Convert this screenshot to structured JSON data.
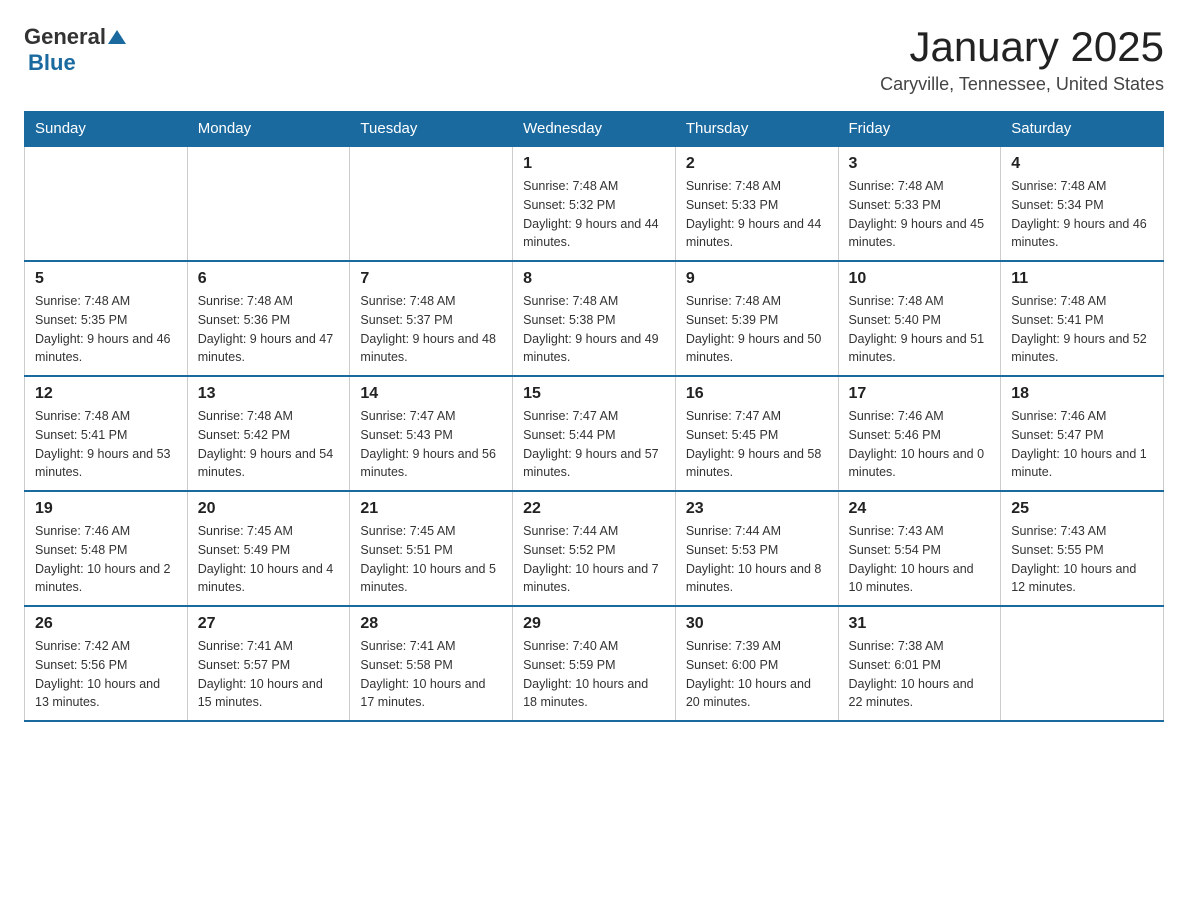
{
  "header": {
    "logo": {
      "general": "General",
      "triangle": "▶",
      "blue": "Blue"
    },
    "title": "January 2025",
    "location": "Caryville, Tennessee, United States"
  },
  "weekdays": [
    "Sunday",
    "Monday",
    "Tuesday",
    "Wednesday",
    "Thursday",
    "Friday",
    "Saturday"
  ],
  "weeks": [
    [
      {
        "day": "",
        "info": ""
      },
      {
        "day": "",
        "info": ""
      },
      {
        "day": "",
        "info": ""
      },
      {
        "day": "1",
        "info": "Sunrise: 7:48 AM\nSunset: 5:32 PM\nDaylight: 9 hours and 44 minutes."
      },
      {
        "day": "2",
        "info": "Sunrise: 7:48 AM\nSunset: 5:33 PM\nDaylight: 9 hours and 44 minutes."
      },
      {
        "day": "3",
        "info": "Sunrise: 7:48 AM\nSunset: 5:33 PM\nDaylight: 9 hours and 45 minutes."
      },
      {
        "day": "4",
        "info": "Sunrise: 7:48 AM\nSunset: 5:34 PM\nDaylight: 9 hours and 46 minutes."
      }
    ],
    [
      {
        "day": "5",
        "info": "Sunrise: 7:48 AM\nSunset: 5:35 PM\nDaylight: 9 hours and 46 minutes."
      },
      {
        "day": "6",
        "info": "Sunrise: 7:48 AM\nSunset: 5:36 PM\nDaylight: 9 hours and 47 minutes."
      },
      {
        "day": "7",
        "info": "Sunrise: 7:48 AM\nSunset: 5:37 PM\nDaylight: 9 hours and 48 minutes."
      },
      {
        "day": "8",
        "info": "Sunrise: 7:48 AM\nSunset: 5:38 PM\nDaylight: 9 hours and 49 minutes."
      },
      {
        "day": "9",
        "info": "Sunrise: 7:48 AM\nSunset: 5:39 PM\nDaylight: 9 hours and 50 minutes."
      },
      {
        "day": "10",
        "info": "Sunrise: 7:48 AM\nSunset: 5:40 PM\nDaylight: 9 hours and 51 minutes."
      },
      {
        "day": "11",
        "info": "Sunrise: 7:48 AM\nSunset: 5:41 PM\nDaylight: 9 hours and 52 minutes."
      }
    ],
    [
      {
        "day": "12",
        "info": "Sunrise: 7:48 AM\nSunset: 5:41 PM\nDaylight: 9 hours and 53 minutes."
      },
      {
        "day": "13",
        "info": "Sunrise: 7:48 AM\nSunset: 5:42 PM\nDaylight: 9 hours and 54 minutes."
      },
      {
        "day": "14",
        "info": "Sunrise: 7:47 AM\nSunset: 5:43 PM\nDaylight: 9 hours and 56 minutes."
      },
      {
        "day": "15",
        "info": "Sunrise: 7:47 AM\nSunset: 5:44 PM\nDaylight: 9 hours and 57 minutes."
      },
      {
        "day": "16",
        "info": "Sunrise: 7:47 AM\nSunset: 5:45 PM\nDaylight: 9 hours and 58 minutes."
      },
      {
        "day": "17",
        "info": "Sunrise: 7:46 AM\nSunset: 5:46 PM\nDaylight: 10 hours and 0 minutes."
      },
      {
        "day": "18",
        "info": "Sunrise: 7:46 AM\nSunset: 5:47 PM\nDaylight: 10 hours and 1 minute."
      }
    ],
    [
      {
        "day": "19",
        "info": "Sunrise: 7:46 AM\nSunset: 5:48 PM\nDaylight: 10 hours and 2 minutes."
      },
      {
        "day": "20",
        "info": "Sunrise: 7:45 AM\nSunset: 5:49 PM\nDaylight: 10 hours and 4 minutes."
      },
      {
        "day": "21",
        "info": "Sunrise: 7:45 AM\nSunset: 5:51 PM\nDaylight: 10 hours and 5 minutes."
      },
      {
        "day": "22",
        "info": "Sunrise: 7:44 AM\nSunset: 5:52 PM\nDaylight: 10 hours and 7 minutes."
      },
      {
        "day": "23",
        "info": "Sunrise: 7:44 AM\nSunset: 5:53 PM\nDaylight: 10 hours and 8 minutes."
      },
      {
        "day": "24",
        "info": "Sunrise: 7:43 AM\nSunset: 5:54 PM\nDaylight: 10 hours and 10 minutes."
      },
      {
        "day": "25",
        "info": "Sunrise: 7:43 AM\nSunset: 5:55 PM\nDaylight: 10 hours and 12 minutes."
      }
    ],
    [
      {
        "day": "26",
        "info": "Sunrise: 7:42 AM\nSunset: 5:56 PM\nDaylight: 10 hours and 13 minutes."
      },
      {
        "day": "27",
        "info": "Sunrise: 7:41 AM\nSunset: 5:57 PM\nDaylight: 10 hours and 15 minutes."
      },
      {
        "day": "28",
        "info": "Sunrise: 7:41 AM\nSunset: 5:58 PM\nDaylight: 10 hours and 17 minutes."
      },
      {
        "day": "29",
        "info": "Sunrise: 7:40 AM\nSunset: 5:59 PM\nDaylight: 10 hours and 18 minutes."
      },
      {
        "day": "30",
        "info": "Sunrise: 7:39 AM\nSunset: 6:00 PM\nDaylight: 10 hours and 20 minutes."
      },
      {
        "day": "31",
        "info": "Sunrise: 7:38 AM\nSunset: 6:01 PM\nDaylight: 10 hours and 22 minutes."
      },
      {
        "day": "",
        "info": ""
      }
    ]
  ]
}
